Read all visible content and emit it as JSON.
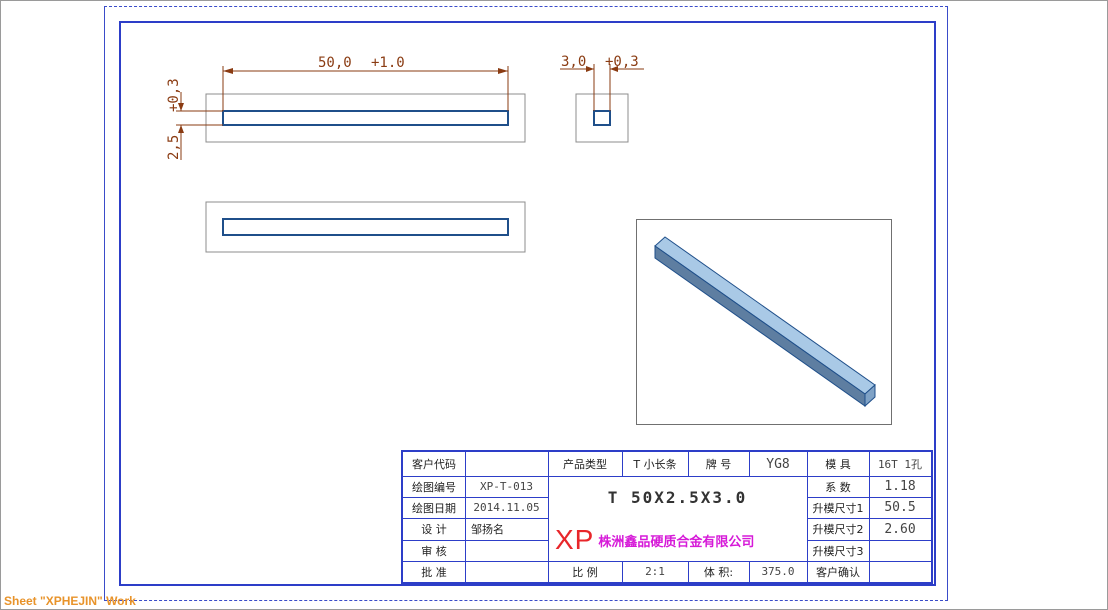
{
  "colors": {
    "frame": "#2d3ec8",
    "part_outline": "#1f4f8a",
    "dimension": "#8a3b12",
    "logo_mark": "#e8262a",
    "logo_company": "#d61ad8",
    "sheet_tab": "#e8932a",
    "part_3d_top": "#a9c9e6",
    "part_3d_side": "#5e7ea1"
  },
  "dimensions": {
    "length_value": "50,0",
    "length_tol": "+1.0",
    "width_value": "3,0",
    "width_tol": "+0,3",
    "thickness_value": "2,5",
    "thickness_tol": "+0,3"
  },
  "title_block": {
    "customer_code_label": "客户代码",
    "customer_code_value": "",
    "drawing_no_label": "绘图编号",
    "drawing_no_value": "XP-T-013",
    "drawing_date_label": "绘图日期",
    "drawing_date_value": "2014.11.05",
    "design_label": "设    计",
    "design_value": "邹扬名",
    "review_label": "审    核",
    "review_value": "",
    "approve_label": "批    准",
    "approve_value": "",
    "product_type_label": "产品类型",
    "product_type_value": "T  小长条",
    "grade_label": "牌    号",
    "grade_value": "YG8",
    "spec": "T  50X2.5X3.0",
    "logo_mark": "XP",
    "company_name": "株洲鑫品硬质合金有限公司",
    "scale_label": "比    例",
    "scale_value": "2:1",
    "volume_label": "体    积:",
    "volume_value": "375.0",
    "mold_label": "模    具",
    "mold_value": "16T  1孔",
    "coef_label": "系    数",
    "coef_value": "1.18",
    "mold_size1_label": "升模尺寸1",
    "mold_size1_value": "50.5",
    "mold_size2_label": "升模尺寸2",
    "mold_size2_value": "2.60",
    "mold_size3_label": "升模尺寸3",
    "mold_size3_value": "",
    "customer_confirm_label": "客户确认",
    "customer_confirm_value": ""
  },
  "sheet_tab": "Sheet \"XPHEJIN\" Work"
}
